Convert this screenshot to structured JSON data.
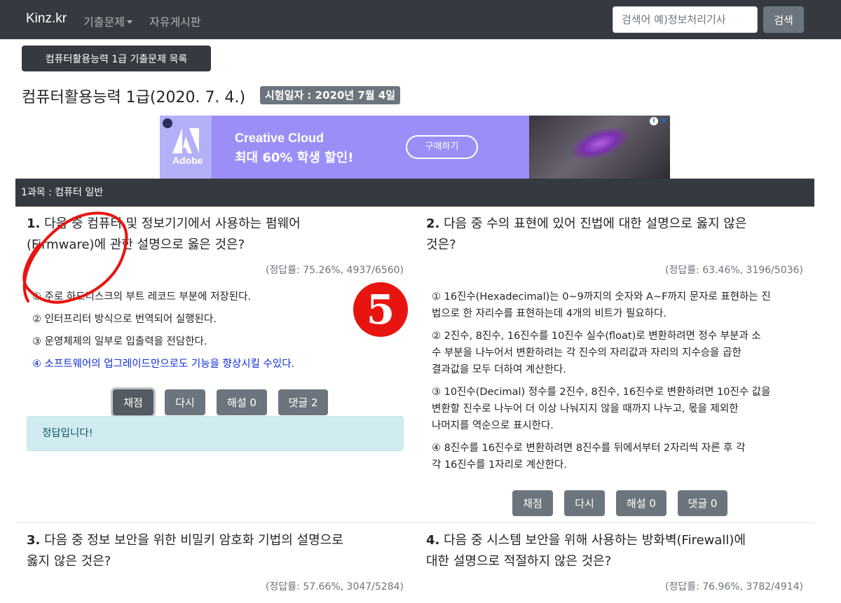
{
  "navbar": {
    "brand": "Kinz.kr",
    "menu": [
      "기출문제",
      "자유게시판"
    ],
    "search": {
      "placeholder": "검색어 예)정보처리기사",
      "button": "검색"
    }
  },
  "list_button": "컴퓨터활용능력 1급 기출문제 목록",
  "exam": {
    "title": "컴퓨터활용능력 1급(2020. 7. 4.)",
    "badge": "시험일자 : 2020년 7월 4일"
  },
  "ad": {
    "brand": "Adobe",
    "line1": "Creative Cloud",
    "line2": "최대 60% 학생 할인!",
    "cta": "구매하기",
    "info": "i",
    "close": "✕"
  },
  "section": "1과목 : 컴퓨터 일반",
  "questions": [
    {
      "num": "1.",
      "line1": "다음 중 컴퓨터 및 정보기기에서 사용하는 펌웨어",
      "line2": "(Firmware)에 관한 설명으로 옳은 것은?",
      "rate": "(정답률: 75.26%, 4937/6560)",
      "options": [
        "① 주로 하드디스크의 부트 레코드 부분에 저장된다.",
        "② 인터프리터 방식으로 번역되어 실행된다.",
        "③ 운영체제의 일부로 입출력을 전담한다.",
        "④ 소프트웨어의 업그레이드만으로도 기능을 향상시킬 수있다."
      ],
      "buttons": [
        "채점",
        "다시",
        "해설 0",
        "댓글 2"
      ],
      "result": "정답입니다!"
    },
    {
      "num": "2.",
      "line1": "다음 중 수의 표현에 있어 진법에 대한 설명으로 옳지 않은",
      "line2": "것은?",
      "rate": "(정답률: 63.46%, 3196/5036)",
      "options": [
        [
          "① 16진수(Hexadecimal)는 0~9까지의 숫자와 A~F까지 문자로 표현하는 진",
          "법으로 한 자리수를 표현하는데 4개의 비트가 필요하다."
        ],
        [
          "② 2진수, 8진수, 16진수를 10진수 실수(float)로 변환하려면 정수 부분과 소",
          "수 부분을 나누어서 변환하려는 각 진수의 자리값과 자리의 지수승을 곱한",
          "결과값을 모두 더하여 계산한다."
        ],
        [
          "③ 10진수(Decimal) 정수를 2진수, 8진수, 16진수로 변환하려면 10진수 값을",
          "변환할 진수로 나누어 더 이상 나눠지지 않을 때까지 나누고, 몫을 제외한",
          "나머지를 역순으로 표시한다."
        ],
        [
          "④ 8진수를 16진수로 변환하려면 8진수를 뒤에서부터 2자리씩 자른 후 각",
          "각 16진수를 1자리로 계산한다."
        ]
      ],
      "buttons": [
        "채점",
        "다시",
        "해설 0",
        "댓글 0"
      ]
    },
    {
      "num": "3.",
      "line1": "다음 중 정보 보안을 위한 비밀키 암호화 기법의 설명으로",
      "line2": "옳지 않은 것은?",
      "rate": "(정답률: 57.66%, 3047/5284)"
    },
    {
      "num": "4.",
      "line1": "다음 중 시스템 보안을 위해 사용하는 방화벽(Firewall)에",
      "line2": "대한 설명으로 적절하지 않은 것은?",
      "rate": "(정답률: 76.96%, 3782/4914)"
    }
  ],
  "annotation": {
    "badge": "5",
    "color": "#e8140f"
  },
  "colors": {
    "navbar": "#343a40",
    "button": "#6c757d",
    "alert_bg": "#d1ecf1",
    "correct_text": "#0d2ed6",
    "ad_bg": "#9b8ff7"
  }
}
